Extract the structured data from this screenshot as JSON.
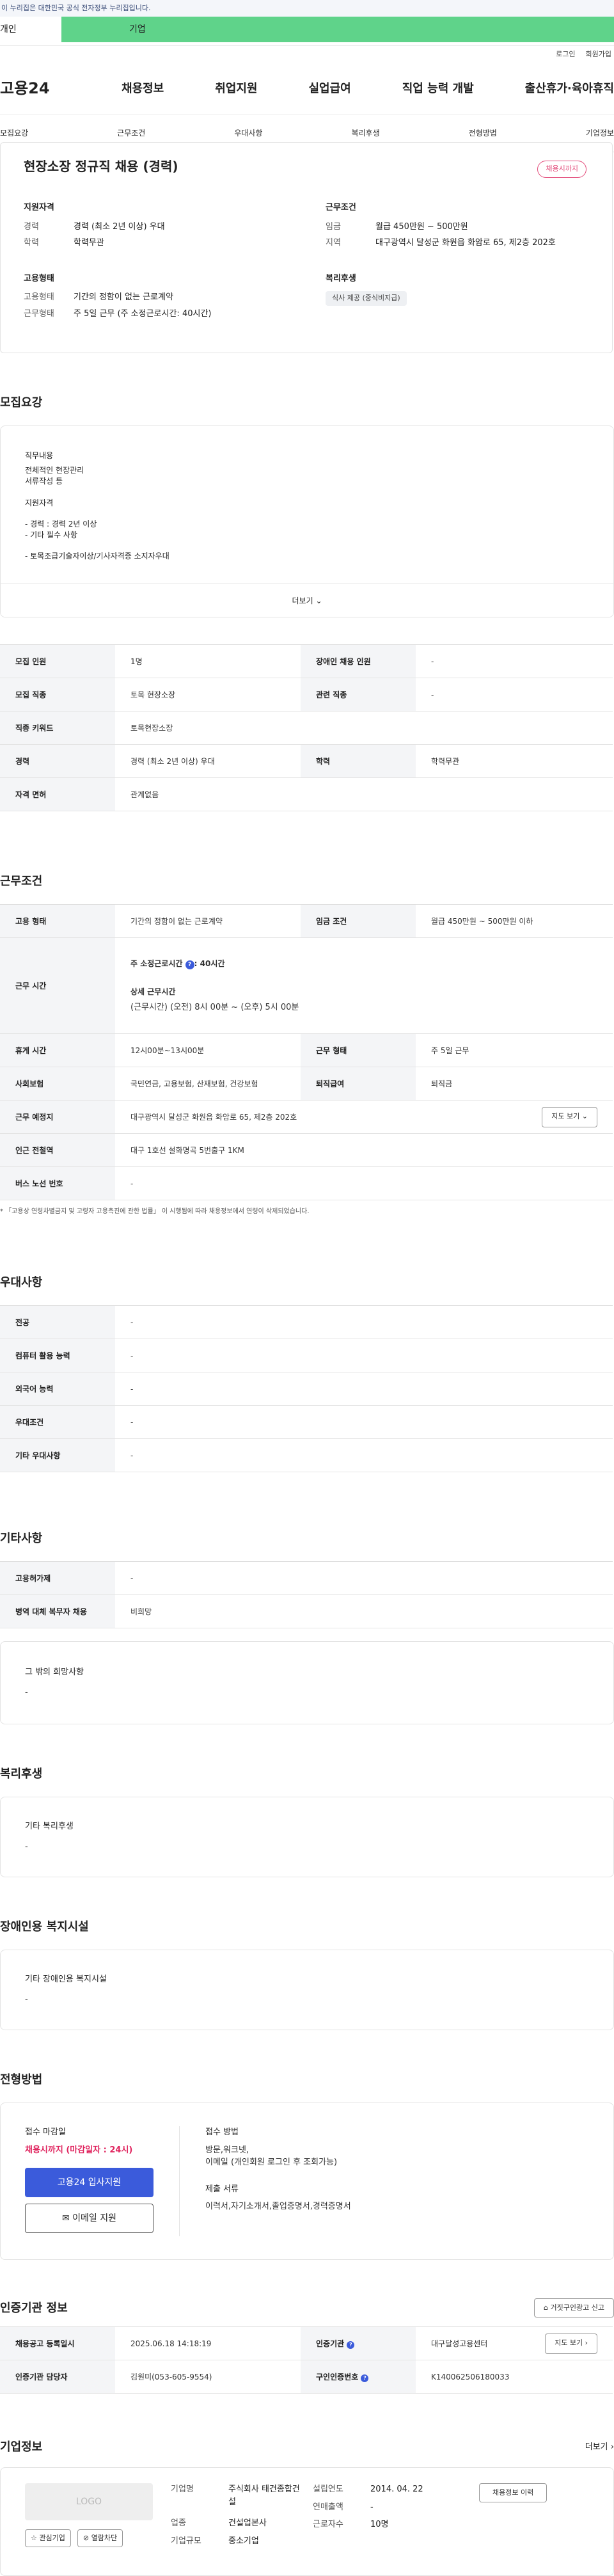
{
  "gov": "이 누리집은 대한민국 공식 전자정부 누리집입니다.",
  "usertabs": [
    "개인",
    "기업"
  ],
  "util": [
    "로그인",
    "회원가입"
  ],
  "logo": "고용24",
  "gnb": [
    "채용정보",
    "취업지원",
    "실업급여",
    "직업 능력 개발",
    "출산휴가·육아휴직"
  ],
  "subnav": [
    "모집요강",
    "근무조건",
    "우대사항",
    "복리후생",
    "전형방법",
    "기업정보"
  ],
  "summary": {
    "title": "현장소장 정규직 채용 (경력)",
    "badge": "채용시까지",
    "qual_title": "지원자격",
    "career_k": "경력",
    "career_v": "경력 (최소 2년 이상) 우대",
    "edu_k": "학력",
    "edu_v": "학력무관",
    "cond_title": "근무조건",
    "wage_k": "임금",
    "wage_v": "월급 450만원 ~ 500만원",
    "loc_k": "지역",
    "loc_v": "대구광역시 달성군 화원읍 화암로 65, 제2층 202호",
    "emp_title": "고용형태",
    "etype_k": "고용형태",
    "etype_v": "기간의 정함이 없는 근로계약",
    "wtype_k": "근무형태",
    "wtype_v": "주 5일 근무 (주 소정근로시간: 40시간)",
    "welfare_title": "복리후생",
    "welfare_chip": "식사 제공 (중식비지급)"
  },
  "recruit": {
    "title": "모집요강",
    "duty_label": "직무내용",
    "duty_lines": [
      "전체적인 현장관리",
      "서류작성 등"
    ],
    "qual_label": "지원자격",
    "qual_lines": [
      "- 경력 : 경력 2년 이상",
      "- 기타 필수 사항"
    ],
    "cert_line": "- 토목조급기술자이상/기사자격증 소지자우대",
    "more": "더보기"
  },
  "rtable": {
    "count_k": "모집 인원",
    "count_v": "1명",
    "disabled_k": "장애인 채용 인원",
    "disabled_v": "-",
    "job_k": "모집 직종",
    "job_v": "토목 현장소장",
    "related_k": "관련 직종",
    "related_v": "-",
    "kw_k": "직종 키워드",
    "kw_v": "토목현장소장",
    "career_k": "경력",
    "career_v": "경력 (최소 2년 이상) 우대",
    "edu_k": "학력",
    "edu_v": "학력무관",
    "license_k": "자격 면허",
    "license_v": "관계없음"
  },
  "work": {
    "title": "근무조건",
    "etype_k": "고용 형태",
    "etype_v": "기간의 정함이 없는 근로계약",
    "wage_k": "임금 조건",
    "wage_v": "월급 450만원 ~ 500만원 이하",
    "time_k": "근무 시간",
    "hours_label": "주 소정근로시간",
    "hours_v": "40시간",
    "detail_label": "상세 근무시간",
    "detail_v": "(근무시간) (오전) 8시 00분 ~ (오후) 5시 00분",
    "rest_k": "휴게 시간",
    "rest_v": "12시00분~13시00분",
    "form_k": "근무 형태",
    "form_v": "주 5일 근무",
    "ins_k": "사회보험",
    "ins_v": "국민연금, 고용보험, 산재보험, 건강보험",
    "ret_k": "퇴직급여",
    "ret_v": "퇴직금",
    "place_k": "근무 예정지",
    "place_v": "대구광역시 달성군 화원읍 화암로 65, 제2층 202호",
    "map": "지도 보기",
    "sub_k": "인근 전철역",
    "sub_v": "대구 1호선 설화명곡 5번출구 1KM",
    "bus_k": "버스 노선 번호",
    "bus_v": "-",
    "note": "* 「고용상 연령차별금지 및 고령자 고용촉진에 관한 법률」 이 시행됨에 따라 채용정보에서 연령이 삭제되었습니다."
  },
  "pref": {
    "title": "우대사항",
    "rows": [
      [
        "전공",
        "-"
      ],
      [
        "컴퓨터 활용 능력",
        "-"
      ],
      [
        "외국어 능력",
        "-"
      ],
      [
        "우대조건",
        "-"
      ],
      [
        "기타 우대사항",
        "-"
      ]
    ]
  },
  "etc": {
    "title": "기타사항",
    "rows": [
      [
        "고용허가제",
        "-"
      ],
      [
        "병역 대체 복무자 채용",
        "비희망"
      ]
    ],
    "hope_label": "그 밖의 희망사항",
    "hope_v": "-"
  },
  "welfare": {
    "title": "복리후생",
    "label": "기타 복리후생",
    "v": "-"
  },
  "disab": {
    "title": "장애인용 복지시설",
    "label": "기타 장애인용 복지시설",
    "v": "-"
  },
  "process": {
    "title": "전형방법",
    "deadline_label": "접수 마감일",
    "deadline_v": "채용시까지 (마감일자 : 24시)",
    "apply": "고용24 입사지원",
    "email": "이메일 지원",
    "method_label": "접수 방법",
    "method_lines": [
      "방문,워크넷,",
      "이메일 (개인회원 로그인 후 조회가능)"
    ],
    "docs_label": "제출 서류",
    "docs_v": "이력서,자기소개서,졸업증명서,경력증명서"
  },
  "cert": {
    "title": "인증기관 정보",
    "report": "거짓구인광고 신고",
    "reg_k": "채용공고 등록일시",
    "reg_v": "2025.06.18 14:18:19",
    "org_k": "인증기관",
    "org_v": "대구달성고용센터",
    "map": "지도 보기",
    "mgr_k": "인증기관 담당자",
    "mgr_v": "김원미(053-605-9554)",
    "no_k": "구인인증번호",
    "no_v": "K140062506180033"
  },
  "company": {
    "title": "기업정보",
    "more": "더보기",
    "logo": "LOGO",
    "fav": "관심기업",
    "block": "열람차단",
    "name_k": "기업명",
    "name_v": "주식회사 태건종합건설",
    "year_k": "설립연도",
    "year_v": "2014. 04. 22",
    "sales_k": "연매출액",
    "sales_v": "-",
    "ind_k": "업종",
    "ind_v": "건설업본사",
    "emp_k": "근로자수",
    "emp_v": "10명",
    "size_k": "기업규모",
    "size_v": "중소기업",
    "hist": "채용정보 이력"
  }
}
